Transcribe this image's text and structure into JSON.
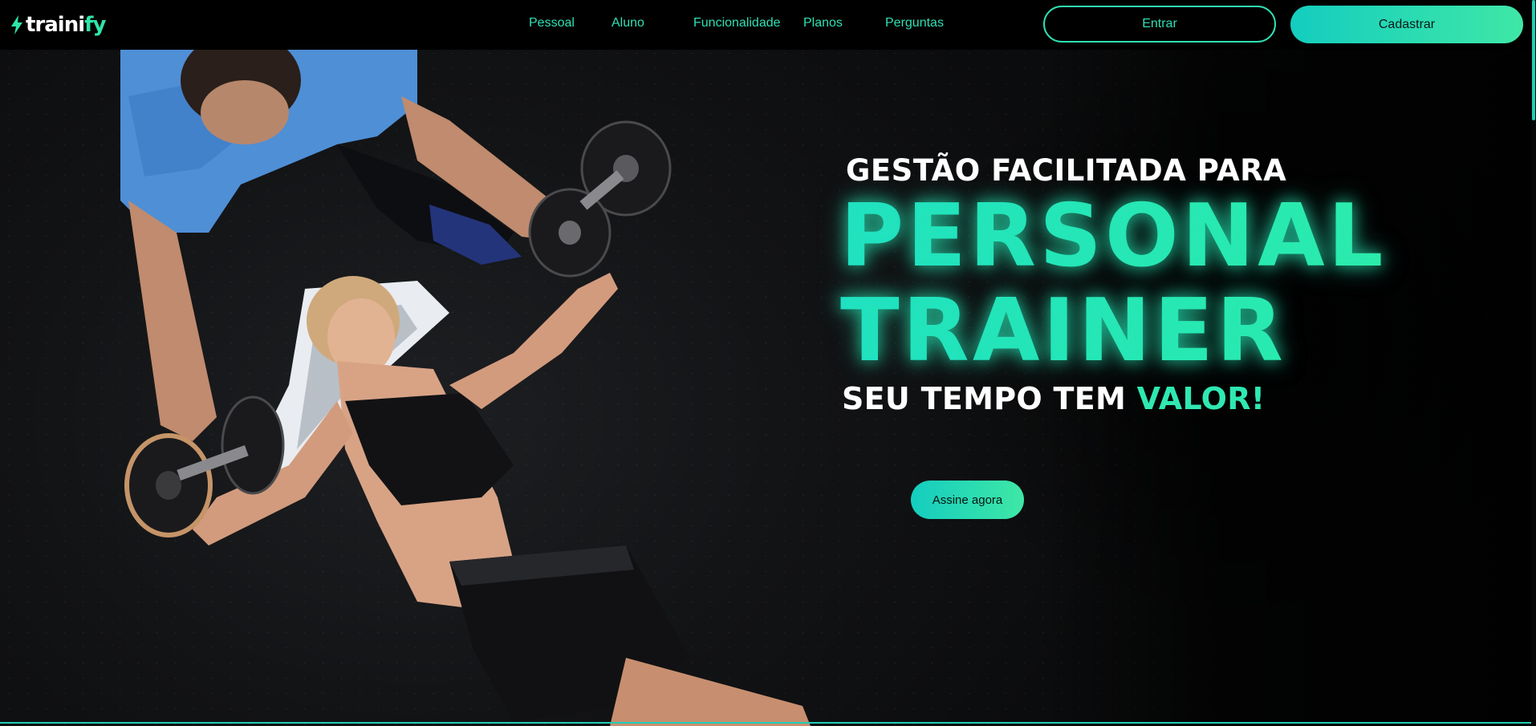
{
  "brand": {
    "name_prefix": "traini",
    "name_accent": "fy",
    "accent_color": "#2fe0b4"
  },
  "nav": {
    "items": [
      {
        "label": "Pessoal"
      },
      {
        "label": "Aluno"
      },
      {
        "label": "Funcionalidade"
      },
      {
        "label": "Planos"
      },
      {
        "label": "Perguntas"
      }
    ],
    "login_label": "Entrar",
    "signup_label": "Cadastrar"
  },
  "hero": {
    "kicker": "GESTÃO FACILITADA PARA",
    "headline_line1": "PERSONAL",
    "headline_line2": "TRAINER",
    "tagline_prefix": "SEU TEMPO TEM ",
    "tagline_accent": "VALOR!",
    "cta_label": "Assine agora",
    "image_subject": "personal trainer assisting woman with dumbbell bench press"
  },
  "icons": {
    "logo_mark": "lightning-bolt-icon"
  }
}
